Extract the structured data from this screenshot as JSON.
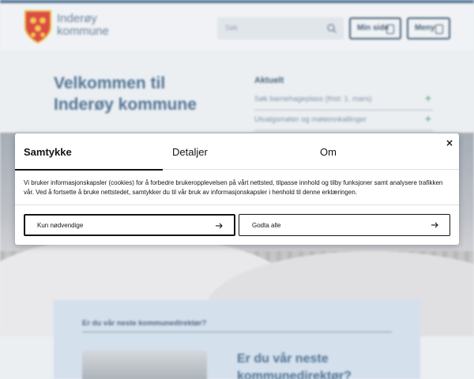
{
  "header": {
    "brand_line1": "Inderøy",
    "brand_line2": "kommune",
    "search_placeholder": "Søk",
    "min_side_label": "Min side",
    "menu_label": "Meny"
  },
  "hero": {
    "welcome_line1": "Velkommen til",
    "welcome_line2": "Inderøy kommune"
  },
  "aktuelt": {
    "heading": "Aktuelt",
    "items": [
      "Søk barnehageplass (frist: 1. mars)",
      "Utvalgsmøter og møteinnkallinger"
    ]
  },
  "job_card": {
    "heading": "Er du vår neste kommunedirektør?",
    "title_line1": "Er du vår neste",
    "title_line2": "kommunedirektør?"
  },
  "consent": {
    "tabs": [
      "Samtykke",
      "Detaljer",
      "Om"
    ],
    "active_tab": "Samtykke",
    "close_symbol": "×",
    "description": "Vi bruker informasjonskapsler (cookies) for å forbedre brukeropplevelsen på vårt nettsted, tilpasse innhold og tilby funksjoner samt analysere trafikken vår. Ved å fortsette å bruke nettstedet, samtykker du til vår bruk av informasjonskapsler i henhold til denne erklæringen.",
    "necessary_label": "Kun nødvendige",
    "accept_label": "Godta alle"
  },
  "colors": {
    "accent": "#3a6186",
    "dark": "#141414",
    "green": "#2e8a5a"
  }
}
